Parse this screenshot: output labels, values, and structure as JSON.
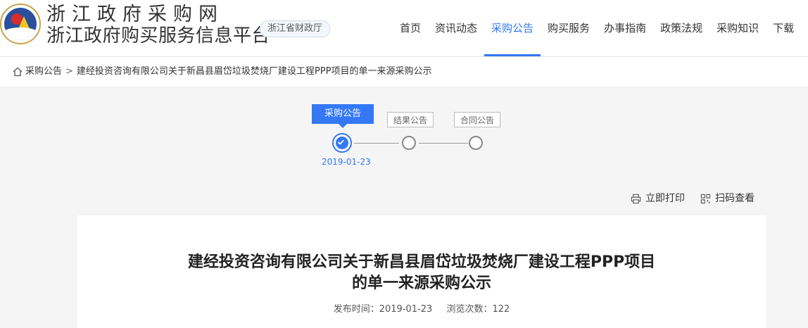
{
  "header": {
    "site_name_1": "浙江政府采购网",
    "site_name_2": "浙江政府购买服务信息平台",
    "dept_tag": "浙江省财政厅",
    "logo_icon": "provincial-emblem-logo"
  },
  "nav": {
    "items": [
      {
        "label": "首页",
        "active": false
      },
      {
        "label": "资讯动态",
        "active": false
      },
      {
        "label": "采购公告",
        "active": true
      },
      {
        "label": "购买服务",
        "active": false
      },
      {
        "label": "办事指南",
        "active": false
      },
      {
        "label": "政策法规",
        "active": false
      },
      {
        "label": "采购知识",
        "active": false
      },
      {
        "label": "下载",
        "active": false
      }
    ],
    "active_color": "#3478f6"
  },
  "breadcrumb": {
    "icon": "home-icon",
    "root": "采购公告",
    "separator": ">",
    "current": "建经投资咨询有限公司关于新昌县眉岱垃圾焚烧厂建设工程PPP项目的单一来源采购公示"
  },
  "progress": {
    "steps": [
      {
        "label": "采购公告",
        "status": "done",
        "date": "2019-01-23"
      },
      {
        "label": "结果公告",
        "status": "pending",
        "date": ""
      },
      {
        "label": "合同公告",
        "status": "pending",
        "date": ""
      }
    ]
  },
  "tools": {
    "print_label": "立即打印",
    "print_icon": "printer-icon",
    "qr_label": "扫码查看",
    "qr_icon": "qrcode-icon"
  },
  "article": {
    "title_line_1": "建经投资咨询有限公司关于新昌县眉岱垃圾焚烧厂建设工程PPP项目",
    "title_line_2": "的单一来源采购公示",
    "publish_label": "发布时间：",
    "publish_date": "2019-01-23",
    "views_label": "浏览次数：",
    "views_count": "122"
  }
}
